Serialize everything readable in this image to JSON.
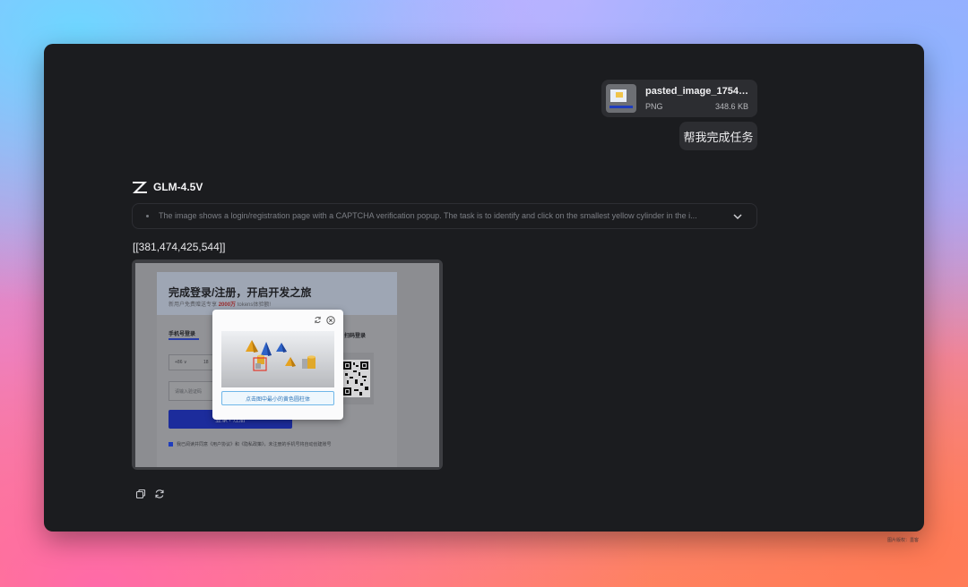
{
  "user_message": {
    "attachment": {
      "name": "pasted_image_17549...",
      "type": "PNG",
      "size": "348.6 KB"
    },
    "text": "帮我完成任务"
  },
  "model": {
    "name": "GLM-4.5V"
  },
  "thinking": {
    "text": "The image shows a login/registration page with a CAPTCHA verification popup. The task is to identify and click on the smallest yellow cylinder in the i..."
  },
  "answer": {
    "text": "[[381,474,425,544]]"
  },
  "screenshot": {
    "title": "完成登录/注册，开启开发之旅",
    "subtitle_prefix": "新用户免费赠送专享",
    "subtitle_highlight": "2000万",
    "subtitle_suffix": "tokens体验额!",
    "tab_phone": "手机号登录",
    "tab_qr": "扫码登录",
    "country_code": "+86 ∨",
    "phone_prefix": "18",
    "code_placeholder": "请输入验证码",
    "login_button": "登录 / 注册",
    "agreement": "我已阅读并同意《用户协议》和《隐私政策》，未注册的手机号将自动创建账号",
    "captcha_instruction": "点击图中最小的黄色圆柱体"
  },
  "watermark": "图片版权：墨客",
  "colors": {
    "window_bg": "#1b1c1f",
    "bubble_bg": "#2c2d31",
    "accent_blue": "#1f3dbd"
  }
}
